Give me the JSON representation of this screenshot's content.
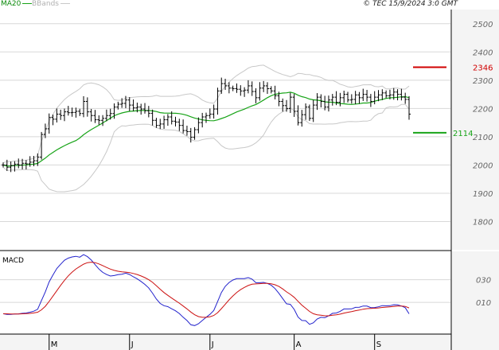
{
  "header": {
    "legend_ma": "MA20",
    "legend_bb": "BBands",
    "source": "© TEC 15/9/2024 3:0 GMT"
  },
  "colors": {
    "ma": "#18a418",
    "bands": "#c8c8c8",
    "bars": "#000000",
    "grid": "#d8d8d8",
    "resistance": "#d00000",
    "support": "#18a418",
    "macd": "#2222cc",
    "signal": "#cc1111",
    "axis_bg": "#f4f4f4"
  },
  "chart_data": [
    {
      "type": "ohlc",
      "ylim": [
        1700,
        2550
      ],
      "y_ticks": [
        1800,
        1900,
        2000,
        2100,
        2200,
        2300,
        2400,
        2500
      ],
      "x_month_labels": [
        {
          "label": "M",
          "bar": 12
        },
        {
          "label": "J",
          "bar": 33
        },
        {
          "label": "J",
          "bar": 54
        },
        {
          "label": "A",
          "bar": 76
        },
        {
          "label": "S",
          "bar": 97
        }
      ],
      "levels": [
        {
          "name": "resistance",
          "value": 2346,
          "label": "2346"
        },
        {
          "name": "support",
          "value": 2114,
          "label": "2114"
        }
      ],
      "closes": [
        2000,
        1992,
        1998,
        2003,
        2000,
        2006,
        2004,
        2010,
        2015,
        2028,
        2108,
        2128,
        2168,
        2162,
        2180,
        2175,
        2188,
        2185,
        2186,
        2190,
        2182,
        2225,
        2188,
        2175,
        2160,
        2158,
        2165,
        2175,
        2182,
        2205,
        2215,
        2218,
        2230,
        2212,
        2202,
        2205,
        2198,
        2192,
        2183,
        2158,
        2140,
        2145,
        2160,
        2170,
        2155,
        2152,
        2140,
        2122,
        2118,
        2098,
        2125,
        2150,
        2170,
        2175,
        2180,
        2198,
        2262,
        2288,
        2280,
        2272,
        2270,
        2268,
        2262,
        2265,
        2280,
        2260,
        2238,
        2272,
        2280,
        2270,
        2262,
        2245,
        2225,
        2210,
        2200,
        2240,
        2190,
        2150,
        2178,
        2205,
        2165,
        2212,
        2240,
        2225,
        2205,
        2230,
        2240,
        2222,
        2238,
        2250,
        2230,
        2232,
        2248,
        2238,
        2250,
        2240,
        2225,
        2240,
        2248,
        2255,
        2245,
        2248,
        2258,
        2250,
        2240,
        2232,
        2180
      ],
      "ohlc_wick": 22,
      "macd": {
        "ylim": [
          -18,
          55
        ],
        "y_ticks": [
          10,
          30
        ],
        "tick_labels": [
          "010",
          "030"
        ],
        "label": "MACD"
      }
    }
  ]
}
